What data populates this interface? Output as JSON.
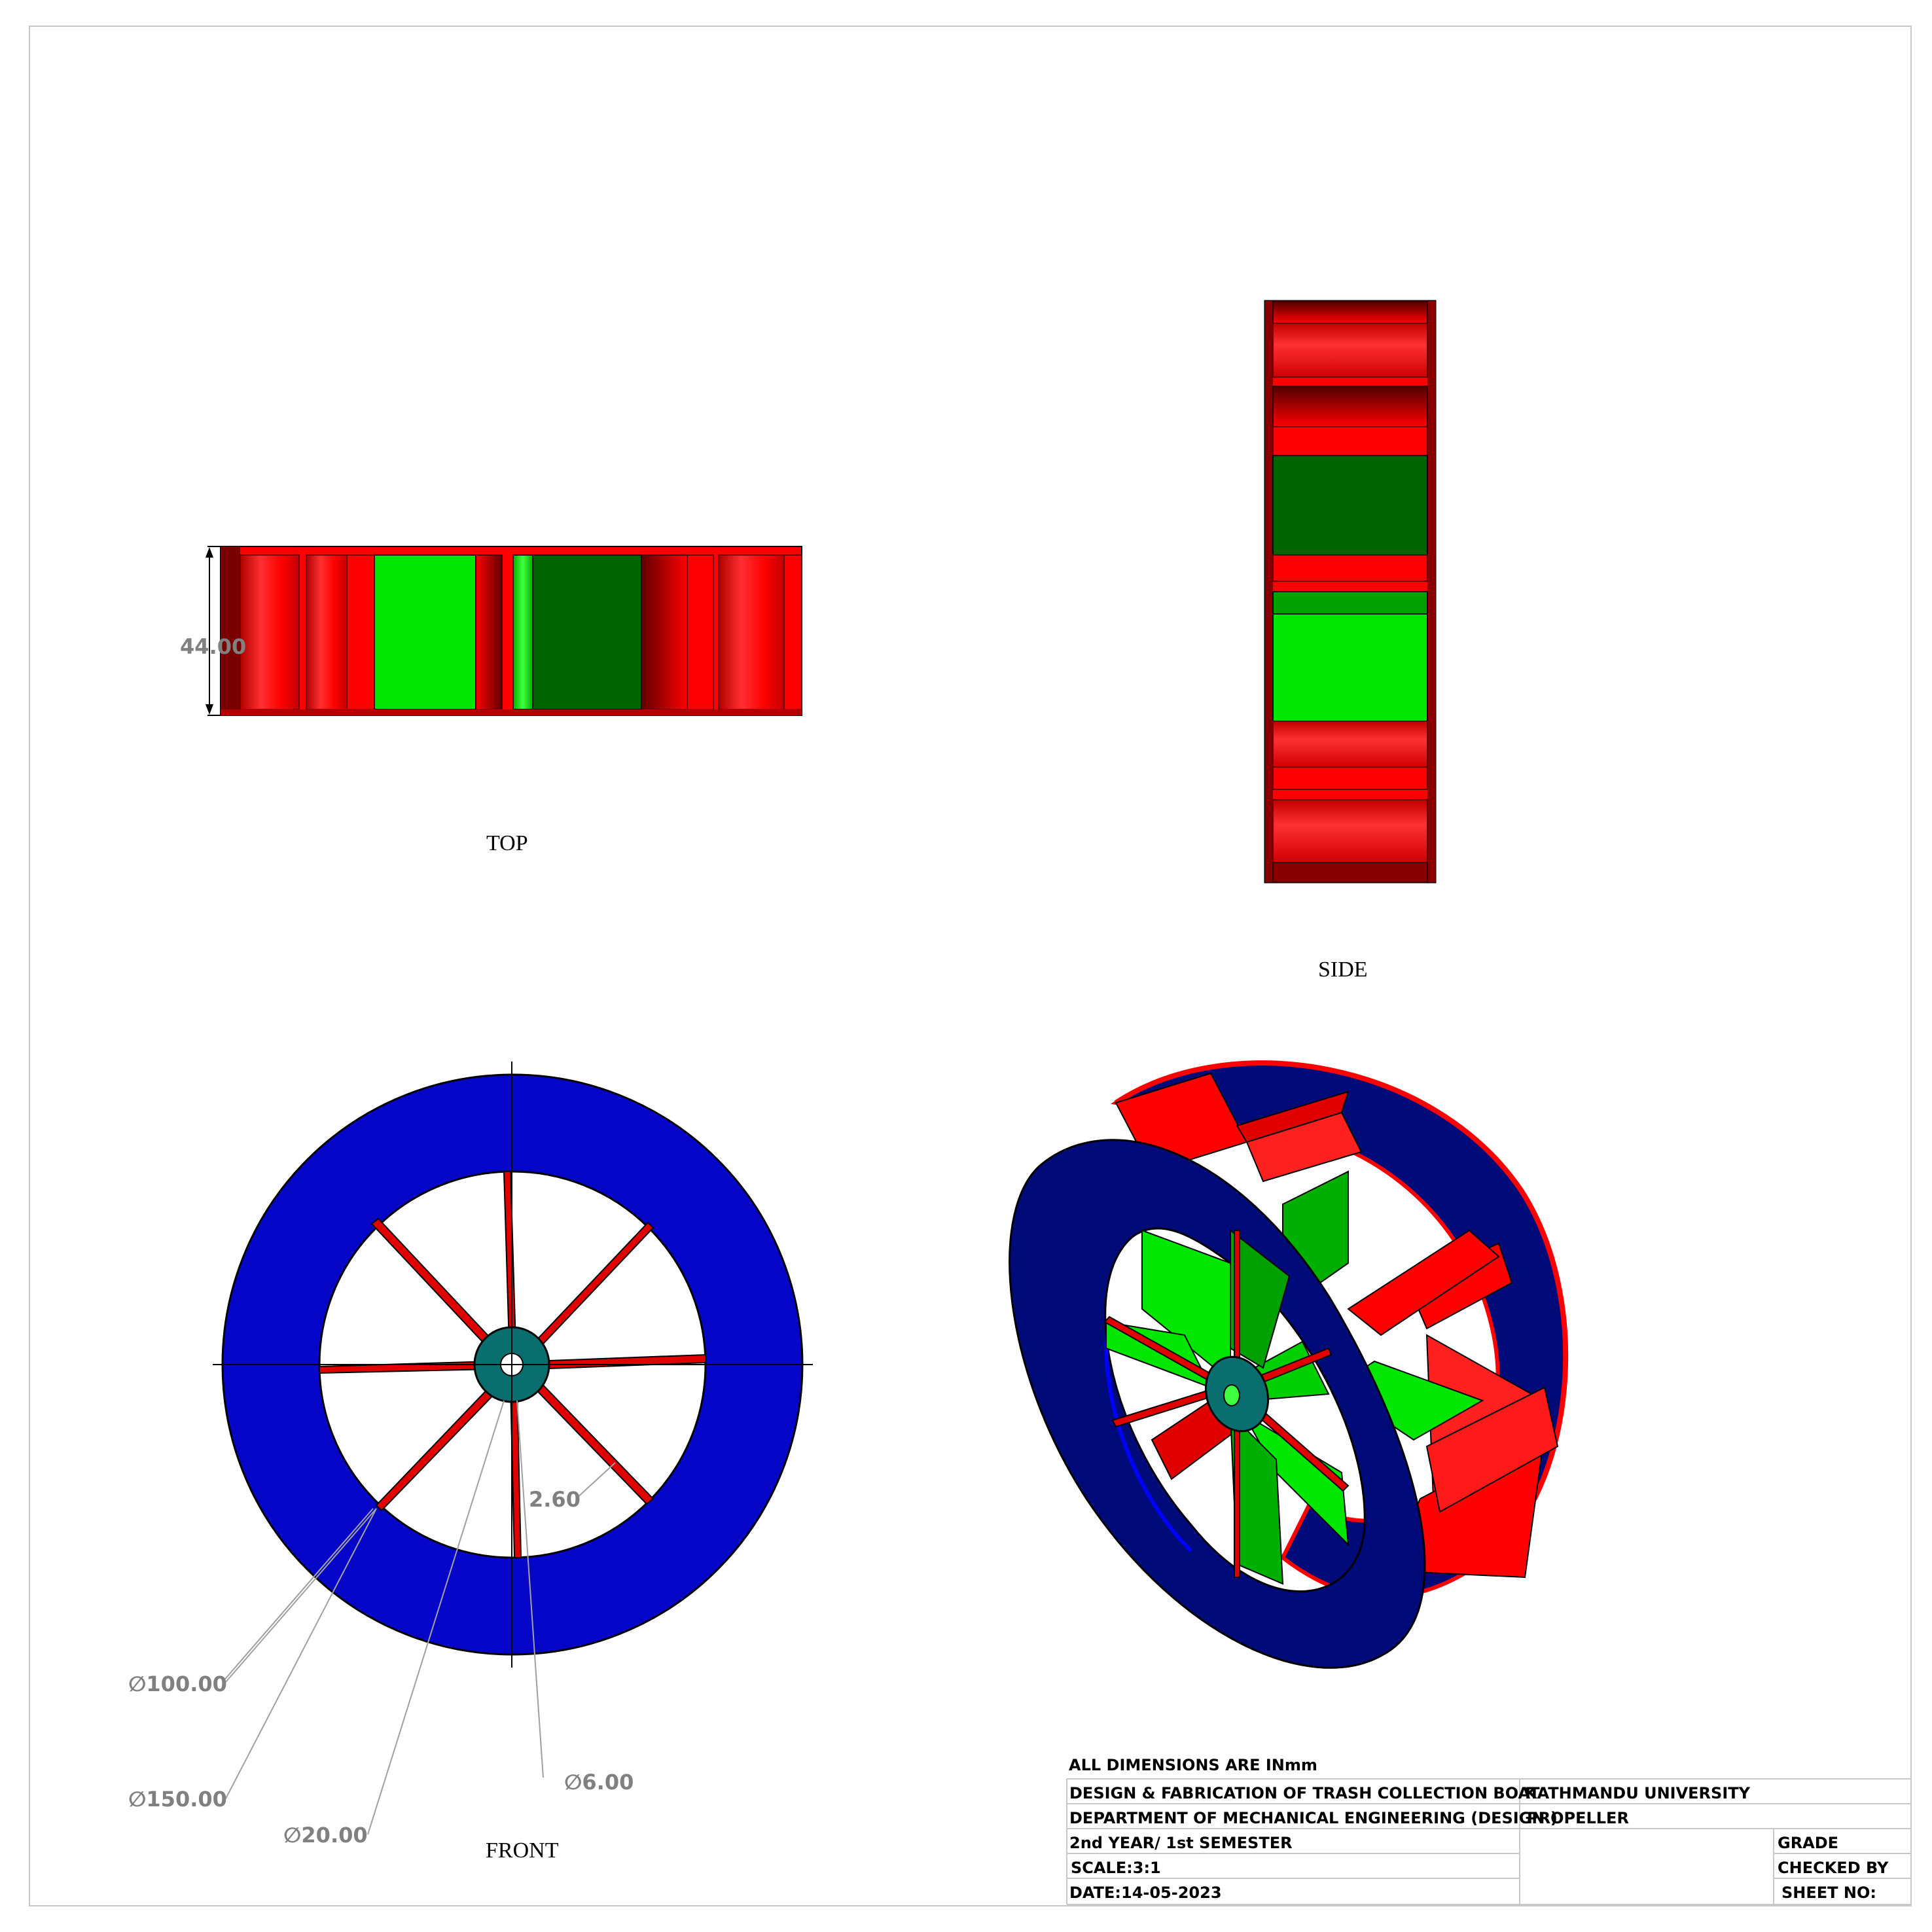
{
  "views": {
    "top": "TOP",
    "side": "SIDE",
    "front": "FRONT"
  },
  "dimensions": {
    "height": "44.00",
    "spoke_width": "2.60",
    "d100": "100.00",
    "d150": "150.00",
    "d20": "20.00",
    "d6": "6.00",
    "diameter_symbol": "∅"
  },
  "title_block": {
    "units_note": "ALL DIMENSIONS ARE INmm",
    "project": "DESIGN & FABRICATION OF TRASH COLLECTION BOAT",
    "university": "KATHMANDU UNIVERSITY",
    "department": "DEPARTMENT OF MECHANICAL ENGINEERING (DESIGN )",
    "part": "PROPELLER",
    "year": "2nd YEAR/ 1st SEMESTER",
    "scale": "SCALE:3:1",
    "date": "DATE:14-05-2023",
    "grade": "GRADE",
    "checked_by": "CHECKED BY",
    "sheet_no": "SHEET NO:"
  },
  "colors": {
    "rim_blue": "#0606c8",
    "rim_navy": "#000a78",
    "red": "#ff0000",
    "dark_red": "#7a0000",
    "green": "#00e600",
    "dark_green": "#006400",
    "hub": "#0a6e6e"
  }
}
